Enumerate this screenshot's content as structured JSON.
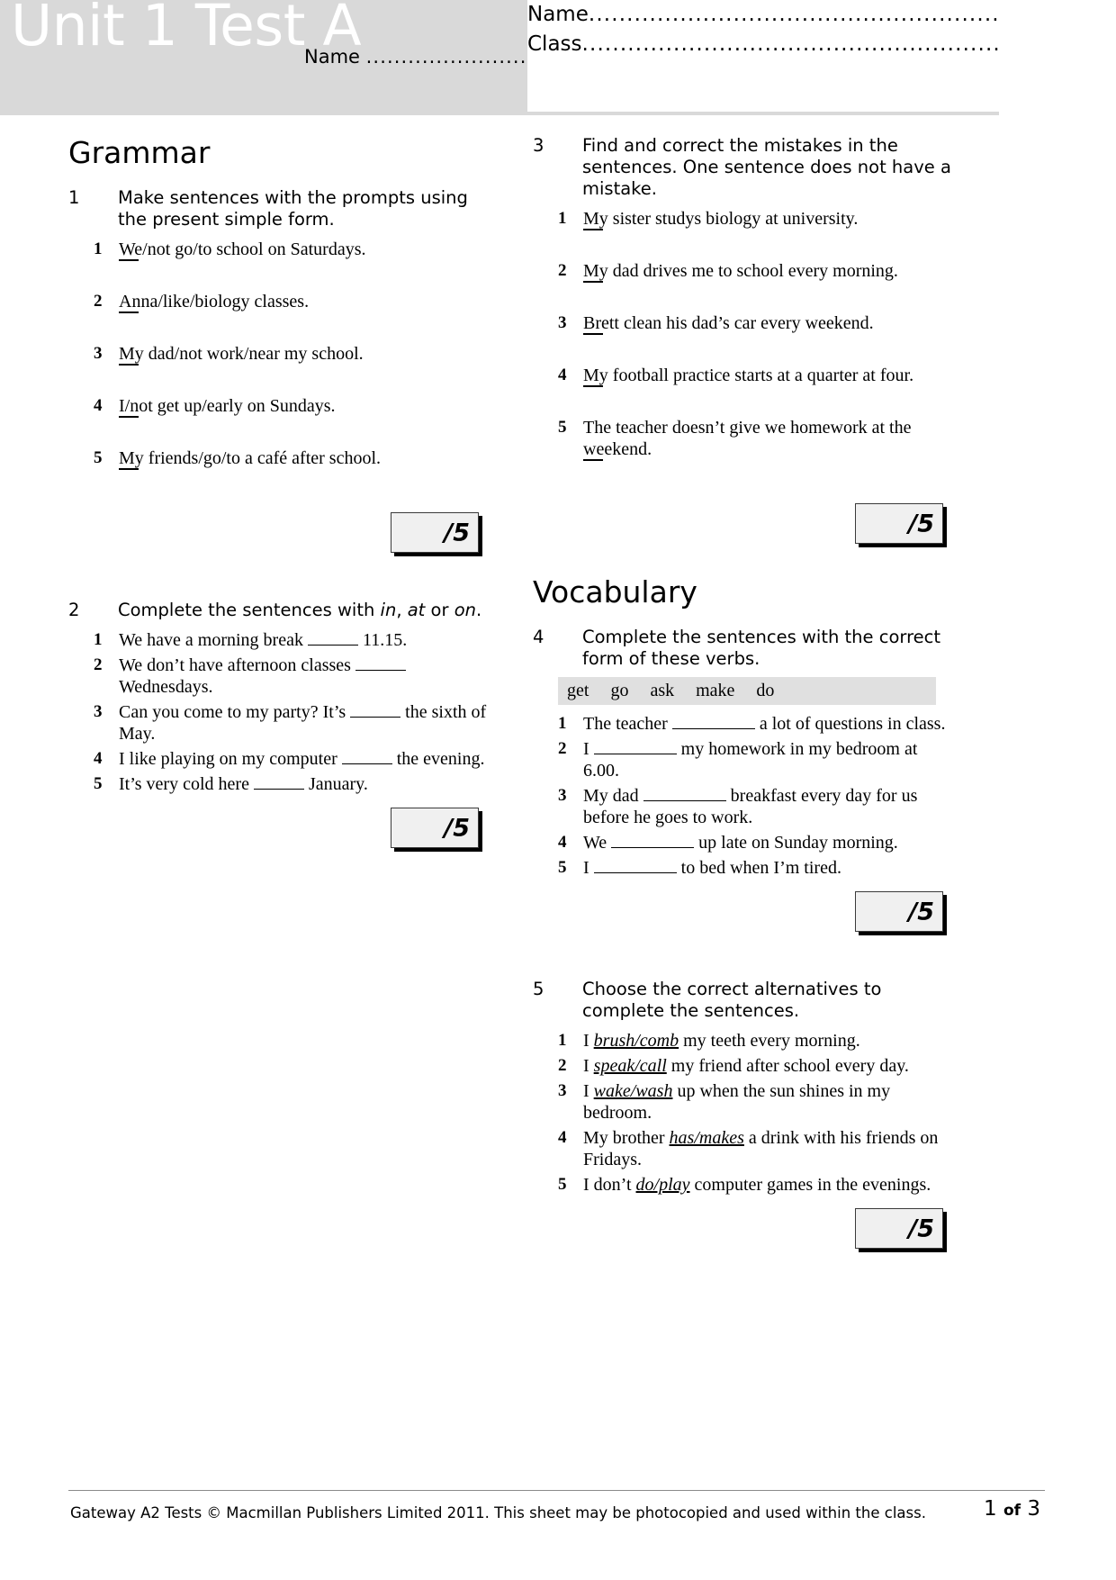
{
  "header": {
    "title": "Unit 1 Test A",
    "overlay_name_label": "Name",
    "overlay_dots": "................................",
    "box_name_label": "Name",
    "box_name_dots": ".............................................................",
    "box_class_label": "Class",
    "box_class_dots": "............................................................."
  },
  "sections": {
    "grammar_title": "Grammar",
    "vocabulary_title": "Vocabulary"
  },
  "exercises": [
    {
      "number": "1",
      "instruction_pre": "Make sentences with the prompts using the present simple form.",
      "items": [
        {
          "n": "1",
          "text": "We/not go/to school on Saturdays."
        },
        {
          "n": "2",
          "text": "Anna/like/biology classes."
        },
        {
          "n": "3",
          "text": "My dad/not work/near my school."
        },
        {
          "n": "4",
          "text": "I/not get up/early on Sundays."
        },
        {
          "n": "5",
          "text": "My friends/go/to a café after school."
        }
      ],
      "score": "/5"
    },
    {
      "number": "2",
      "instruction_parts": [
        {
          "t": "Complete the sentences with ",
          "i": false
        },
        {
          "t": "in",
          "i": true
        },
        {
          "t": ", ",
          "i": false
        },
        {
          "t": "at",
          "i": true
        },
        {
          "t": " or ",
          "i": false
        },
        {
          "t": "on",
          "i": true
        },
        {
          "t": ".",
          "i": false
        }
      ],
      "items": [
        {
          "n": "1",
          "before": "We have a morning break ",
          "after": " 11.15."
        },
        {
          "n": "2",
          "before": "We don’t have afternoon classes ",
          "after": " Wednesdays."
        },
        {
          "n": "3",
          "before": "Can you come to my party? It’s ",
          "after": " the sixth of May."
        },
        {
          "n": "4",
          "before": "I like playing on my computer ",
          "after": " the evening."
        },
        {
          "n": "5",
          "before": "It’s very cold here ",
          "after": " January."
        }
      ],
      "score": "/5"
    },
    {
      "number": "3",
      "instruction_pre": "Find and correct the mistakes in the sentences. One sentence does not have a mistake.",
      "items": [
        {
          "n": "1",
          "text": "My sister studys biology at university."
        },
        {
          "n": "2",
          "text": "My dad drives me to school every morning."
        },
        {
          "n": "3",
          "text": "Brett clean his dad’s car every weekend."
        },
        {
          "n": "4",
          "text": "My football practice starts at a quarter at four."
        },
        {
          "n": "5",
          "text": "The teacher doesn’t give we homework at the weekend."
        }
      ],
      "score": "/5"
    },
    {
      "number": "4",
      "instruction_pre": "Complete the sentences with the correct form of these verbs.",
      "wordbank": [
        "get",
        "go",
        "ask",
        "make",
        "do"
      ],
      "items": [
        {
          "n": "1",
          "before": "The teacher ",
          "after": " a lot of questions in class."
        },
        {
          "n": "2",
          "before": "I ",
          "after": " my homework in my bedroom at 6.00."
        },
        {
          "n": "3",
          "before": "My dad ",
          "after": " breakfast every day for us before he goes to work."
        },
        {
          "n": "4",
          "before": "We ",
          "after": " up late on Sunday morning."
        },
        {
          "n": "5",
          "before": "I ",
          "after": " to bed when I’m tired."
        }
      ],
      "score": "/5"
    },
    {
      "number": "5",
      "instruction_pre": "Choose the correct alternatives to complete the sentences.",
      "items": [
        {
          "n": "1",
          "before": "I ",
          "choice": "brush/comb",
          "after": " my teeth every morning."
        },
        {
          "n": "2",
          "before": "I ",
          "choice": "speak/call",
          "after": " my friend after school every day."
        },
        {
          "n": "3",
          "before": "I ",
          "choice": "wake/wash",
          "after": " up when the sun shines in my bedroom."
        },
        {
          "n": "4",
          "before": "My brother ",
          "choice": "has/makes",
          "after": " a drink with his friends on Fridays."
        },
        {
          "n": "5",
          "before": "I don’t ",
          "choice": "do/play",
          "after": " computer games in the evenings."
        }
      ],
      "score": "/5"
    }
  ],
  "footer": {
    "copyright": "Gateway A2 Tests © Macmillan Publishers Limited 2011. This sheet may be photocopied and used within the class.",
    "page_current": "1",
    "page_of": "of",
    "page_total": "3"
  }
}
